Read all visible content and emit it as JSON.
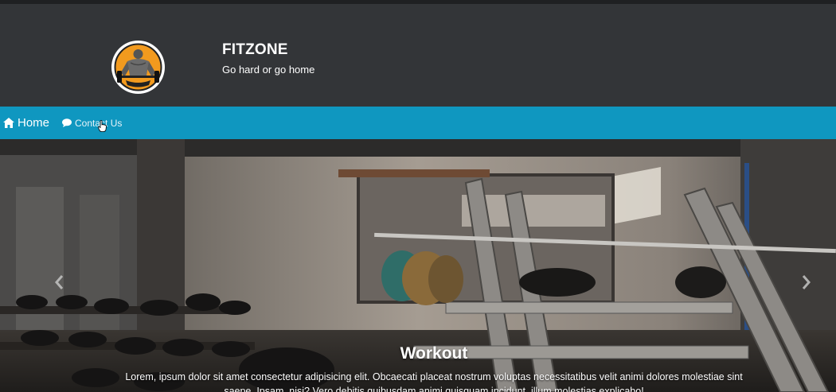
{
  "brand": {
    "title": "FITZONE",
    "tagline": "Go hard or go home",
    "logo_icon": "bodybuilder-logo-icon"
  },
  "nav": {
    "items": [
      {
        "label": "Home",
        "icon": "home-icon"
      },
      {
        "label": "Contact Us",
        "icon": "chat-bubble-icon"
      }
    ]
  },
  "carousel": {
    "caption_title": "Workout",
    "caption_text": "Lorem, ipsum dolor sit amet consectetur adipisicing elit. Obcaecati placeat nostrum voluptas necessitatibus velit animi dolores molestiae sint saepe. Ipsam, nisi? Vero debitis quibusdam animi quisquam incidunt, illum molestias explicabo!",
    "prev_icon": "chevron-left-icon",
    "next_icon": "chevron-right-icon"
  },
  "colors": {
    "header_bg": "#333538",
    "nav_bg": "#0f97c0",
    "logo_accent": "#f29a1e"
  }
}
